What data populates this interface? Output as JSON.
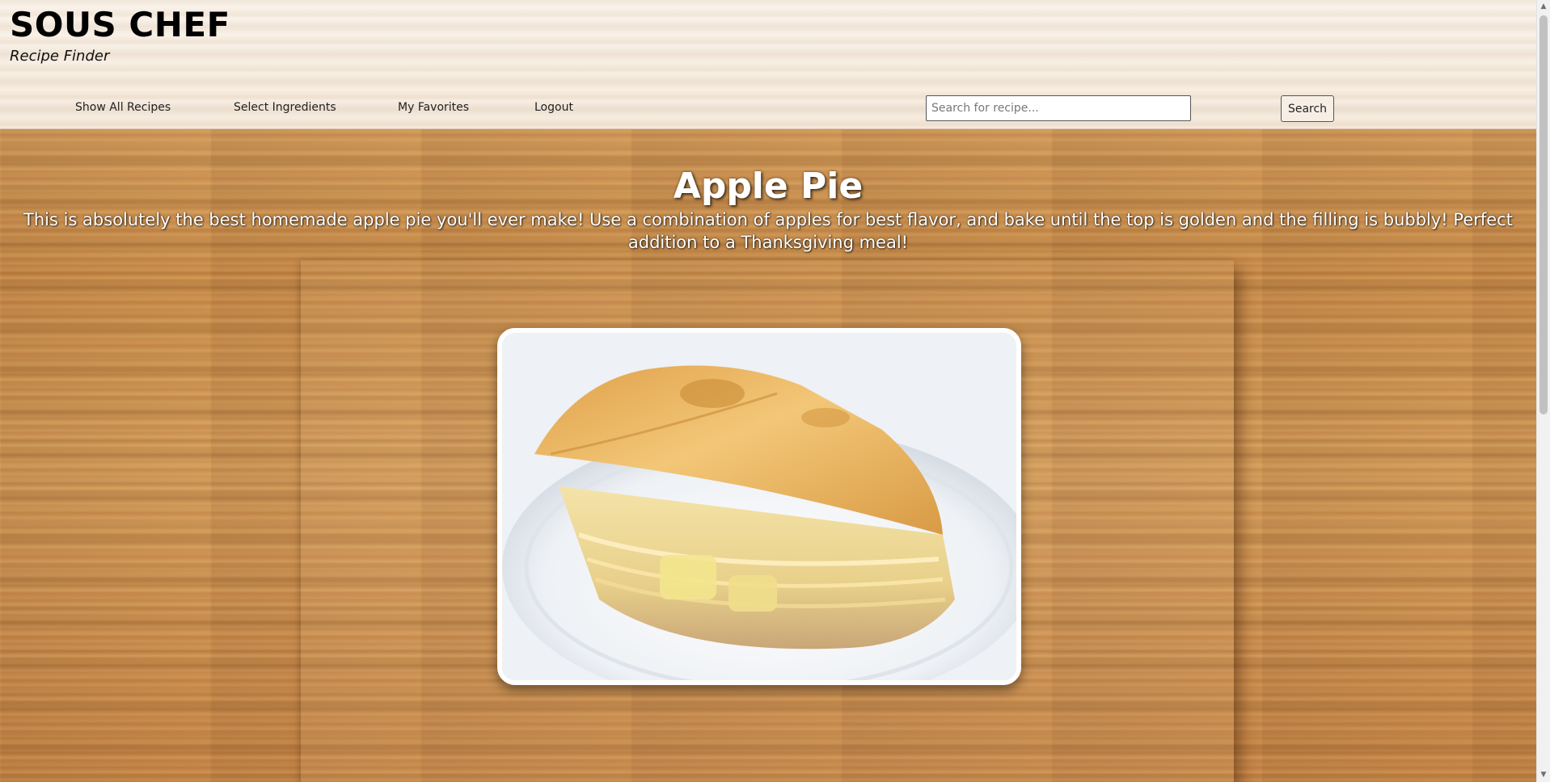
{
  "header": {
    "brand_title": "SOUS CHEF",
    "brand_subtitle": "Recipe Finder"
  },
  "nav": {
    "items": [
      {
        "label": "Show All Recipes"
      },
      {
        "label": "Select Ingredients"
      },
      {
        "label": "My Favorites"
      },
      {
        "label": "Logout"
      }
    ]
  },
  "search": {
    "placeholder": "Search for recipe...",
    "value": "",
    "button_label": "Search"
  },
  "recipe": {
    "title": "Apple Pie",
    "description": "This is absolutely the best homemade apple pie you'll ever make! Use a combination of apples for best flavor, and bake until the top is golden and the filling is bubbly! Perfect addition to a Thanksgiving meal!",
    "image_subject": "apple-pie-slice"
  },
  "colors": {
    "header_bg": "#f6ebdf",
    "wood_base": "#c98f4a",
    "text_light": "#ffffff",
    "text_dark": "#000000"
  }
}
